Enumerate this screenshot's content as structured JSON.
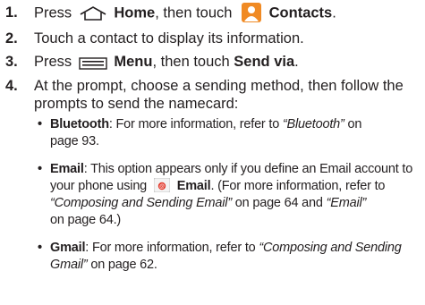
{
  "steps": [
    {
      "num": "1.",
      "press": "Press",
      "home": "Home",
      "then_touch": ", then touch",
      "contacts": "Contacts",
      "end": "."
    },
    {
      "num": "2.",
      "text": "Touch a contact to display its information."
    },
    {
      "num": "3.",
      "press": "Press",
      "menu": "Menu",
      "then_touch": ", then touch",
      "send_via": "Send via",
      "end": "."
    },
    {
      "num": "4.",
      "line1": "At the prompt, choose a sending method, then follow the",
      "line2": "prompts to send the namecard:"
    }
  ],
  "bullets": [
    {
      "term": "Bluetooth",
      "l1": ": For more information, refer to ",
      "ref1": "“Bluetooth”",
      "l1b": " on",
      "l2": "page 93."
    },
    {
      "term": "Email",
      "l1": ": This option appears only if you define an Email account to",
      "l2a": "your phone using",
      "l2term": "Email",
      "l2b": ". (For more information, refer to",
      "ref1": "“Composing and Sending Email”",
      "l3b": " on page 64 and ",
      "ref2": "“Email”",
      "l4": "on page 64.)"
    },
    {
      "term": "Gmail",
      "l1": ": For more information, refer to ",
      "ref1a": "“Composing and Sending",
      "ref1b": "Gmail”",
      "l2b": " on page 62."
    }
  ],
  "bullet_char": "•",
  "icons": [
    "home-icon",
    "contacts-icon",
    "menu-icon",
    "email-icon"
  ],
  "colors": {
    "text": "#231f20",
    "contacts_icon": "#f08a24",
    "email_icon": "#e23b2e"
  }
}
